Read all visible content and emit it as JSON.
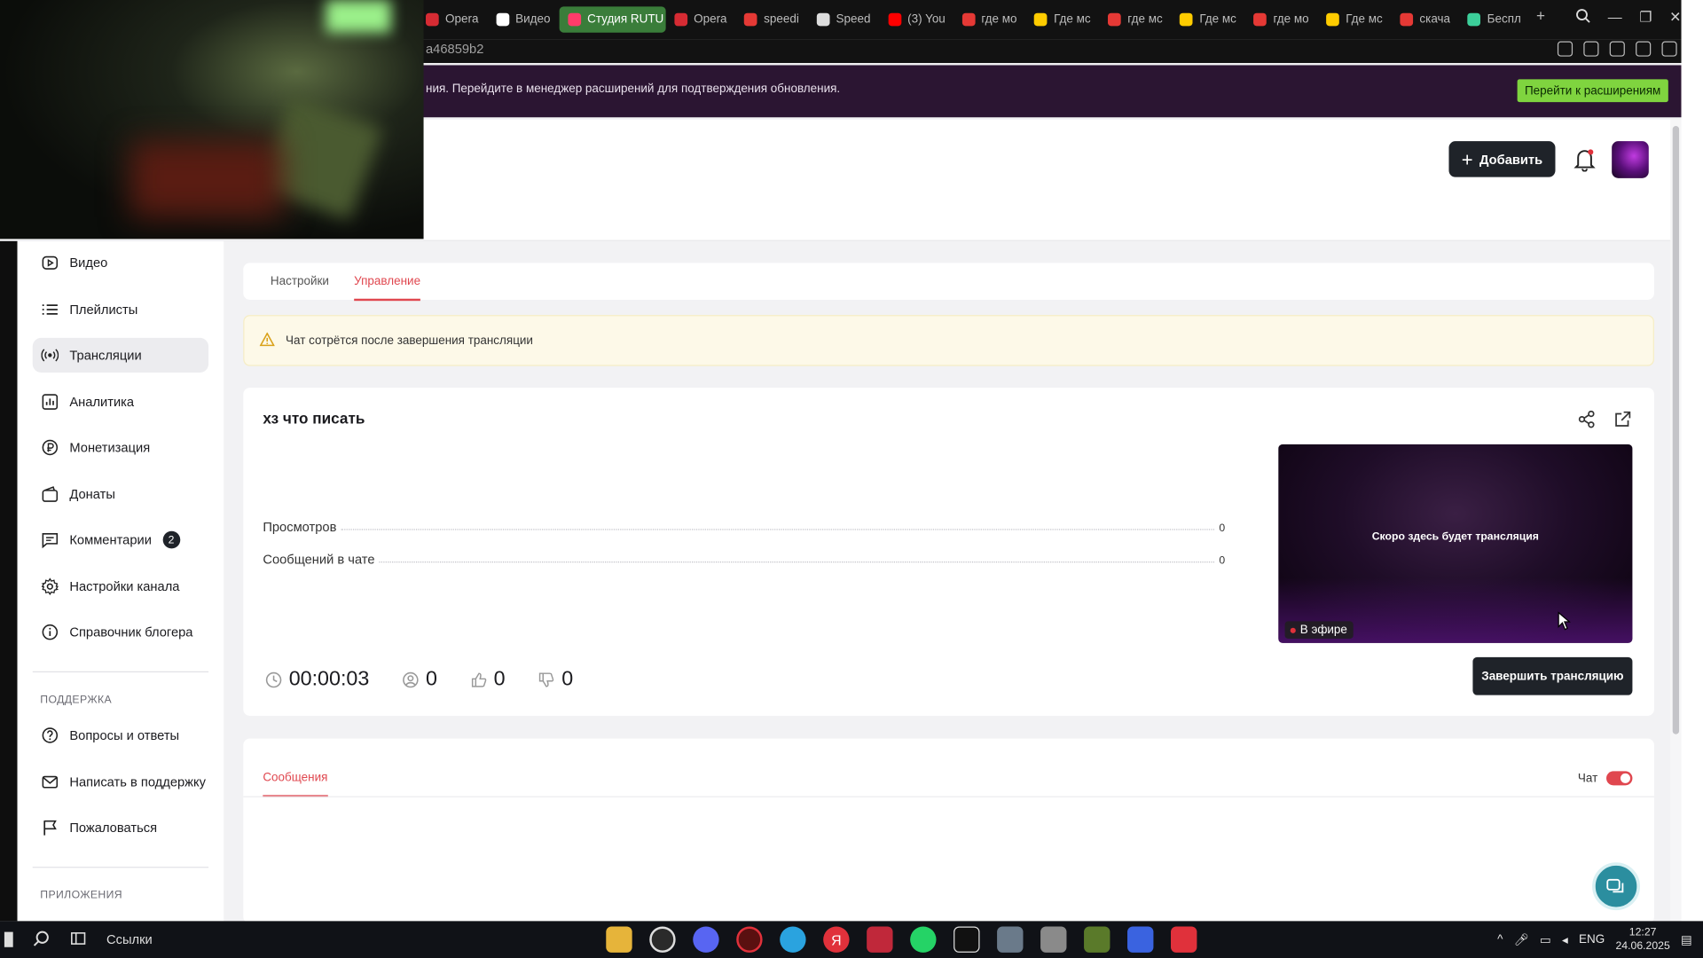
{
  "browser": {
    "tabs": [
      {
        "label": "Opera",
        "color": "#d62b33"
      },
      {
        "label": "Видео",
        "color": "#ffffff"
      },
      {
        "label": "Студия RUTU",
        "color": "#ff3b6a",
        "active": true
      },
      {
        "label": "Opera",
        "color": "#d62b33"
      },
      {
        "label": "speedi",
        "color": "#e53935"
      },
      {
        "label": "Speed",
        "color": "#dddddd"
      },
      {
        "label": "(3) You",
        "color": "#ff0000"
      },
      {
        "label": "где мо",
        "color": "#e53935"
      },
      {
        "label": "Где мс",
        "color": "#ffcc00"
      },
      {
        "label": "где мс",
        "color": "#e53935"
      },
      {
        "label": "Где мс",
        "color": "#ffcc00"
      },
      {
        "label": "где мо",
        "color": "#e53935"
      },
      {
        "label": "Где мс",
        "color": "#ffcc00"
      },
      {
        "label": "скача",
        "color": "#e53935"
      },
      {
        "label": "Беспл",
        "color": "#3ccf9a"
      }
    ],
    "tab_add": "+",
    "url_fragment": "a46859b2",
    "notice_text": "ния. Перейдите в менеджер расширений для подтверждения обновления.",
    "notice_button": "Перейти к расширениям"
  },
  "header": {
    "add_label": "Добавить"
  },
  "sidebar": {
    "items": [
      {
        "label": "Видео",
        "icon": "video-icon"
      },
      {
        "label": "Плейлисты",
        "icon": "list-icon"
      },
      {
        "label": "Трансляции",
        "icon": "broadcast-icon",
        "active": true
      },
      {
        "label": "Аналитика",
        "icon": "analytics-icon"
      },
      {
        "label": "Монетизация",
        "icon": "ruble-icon"
      },
      {
        "label": "Донаты",
        "icon": "wallet-icon"
      },
      {
        "label": "Комментарии",
        "icon": "comment-icon",
        "badge": "2"
      },
      {
        "label": "Настройки канала",
        "icon": "gear-icon"
      },
      {
        "label": "Справочник блогера",
        "icon": "info-icon"
      }
    ],
    "support_heading": "ПОДДЕРЖКА",
    "support_items": [
      {
        "label": "Вопросы и ответы",
        "icon": "question-icon"
      },
      {
        "label": "Написать в поддержку",
        "icon": "mail-icon"
      },
      {
        "label": "Пожаловаться",
        "icon": "flag-icon"
      }
    ],
    "apps_heading": "ПРИЛОЖЕНИЯ"
  },
  "main": {
    "tabs": [
      {
        "label": "Настройки"
      },
      {
        "label": "Управление",
        "active": true
      }
    ],
    "warning": "Чат сотрётся после завершения трансляции",
    "stream": {
      "title": "хз что писать",
      "stats": [
        {
          "label": "Просмотров",
          "value": "0"
        },
        {
          "label": "Сообщений в чате",
          "value": "0"
        }
      ],
      "preview_text": "Скоро здесь будет трансляция",
      "live_label": "В эфире",
      "end_button": "Завершить трансляцию",
      "duration": "00:00:03",
      "viewers": "0",
      "likes": "0",
      "dislikes": "0"
    },
    "messages": {
      "tab_label": "Сообщения",
      "chat_label": "Чат",
      "chat_enabled": true
    }
  },
  "taskbar": {
    "search_label": "Ссылки",
    "lang": "ENG",
    "time": "12:27",
    "date": "24.06.2025"
  },
  "colors": {
    "accent": "#e0474f",
    "dark_button": "#1f2329",
    "notice_bg": "#2b1532",
    "notice_button": "#7fd43f"
  }
}
